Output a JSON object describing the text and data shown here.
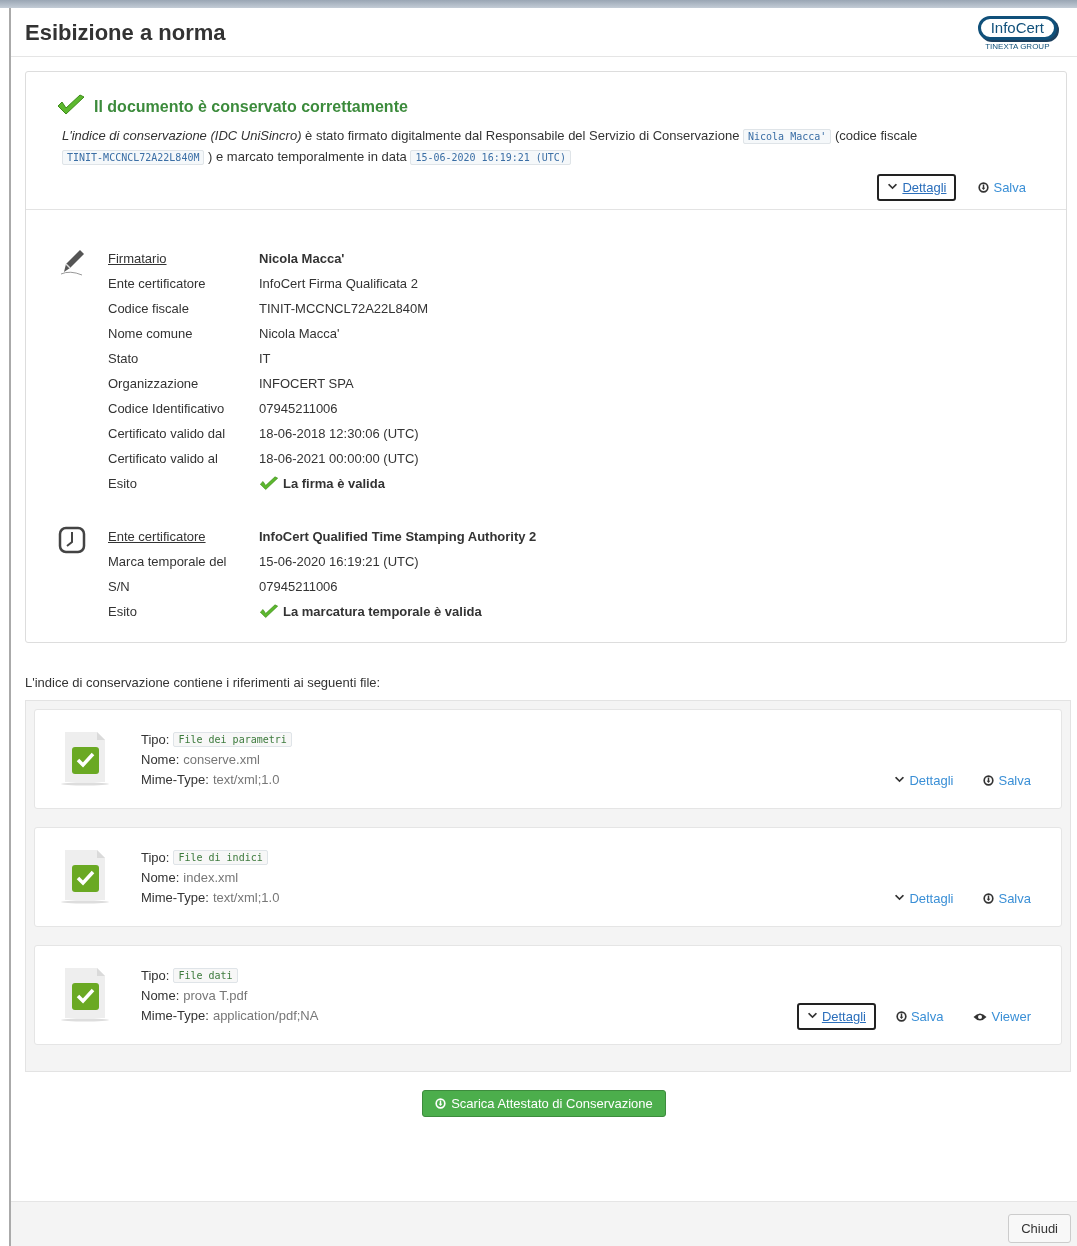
{
  "window": {
    "title": "Esibizione a norma",
    "logo": {
      "name": "InfoCert",
      "group": "TINEXTA GROUP"
    }
  },
  "summary": {
    "status": "Il documento è conservato correttamente",
    "paragraph": [
      {
        "kind": "italic",
        "text": "L'indice di conservazione (IDC UniSincro)"
      },
      {
        "kind": "text",
        "text": " è stato firmato digitalmente dal Responsabile del Servizio di Conservazione "
      },
      {
        "kind": "code",
        "text": "Nicola Macca'"
      },
      {
        "kind": "text",
        "text": " (codice fiscale "
      },
      {
        "kind": "code",
        "text": "TINIT-MCCNCL72A22L840M"
      },
      {
        "kind": "text",
        "text": " ) e marcato temporalmente in data "
      },
      {
        "kind": "code",
        "text": "15-06-2020 16:19:21 (UTC)"
      }
    ],
    "actions": [
      {
        "kind": "details",
        "label": "Dettagli",
        "focused": true
      },
      {
        "kind": "save",
        "label": "Salva",
        "focused": false
      }
    ]
  },
  "sections": [
    {
      "kind": "signature",
      "rows": [
        {
          "kind": "header",
          "label": "Firmatario",
          "value": "Nicola Macca'"
        },
        {
          "kind": "plain",
          "label": "Ente certificatore",
          "value": "InfoCert Firma Qualificata 2"
        },
        {
          "kind": "plain",
          "label": "Codice fiscale",
          "value": "TINIT-MCCNCL72A22L840M"
        },
        {
          "kind": "plain",
          "label": "Nome comune",
          "value": "Nicola Macca'"
        },
        {
          "kind": "plain",
          "label": "Stato",
          "value": "IT"
        },
        {
          "kind": "plain",
          "label": "Organizzazione",
          "value": "INFOCERT SPA"
        },
        {
          "kind": "plain",
          "label": "Codice Identificativo",
          "value": "07945211006"
        },
        {
          "kind": "plain",
          "label": "Certificato valido dal",
          "value": "18-06-2018 12:30:06 (UTC)"
        },
        {
          "kind": "plain",
          "label": "Certificato valido al",
          "value": "18-06-2021 00:00:00 (UTC)"
        },
        {
          "kind": "result",
          "label": "Esito",
          "value": "La firma è valida"
        }
      ]
    },
    {
      "kind": "timestamp",
      "rows": [
        {
          "kind": "header",
          "label": "Ente certificatore",
          "value": "InfoCert Qualified Time Stamping Authority 2"
        },
        {
          "kind": "plain",
          "label": "Marca temporale del",
          "value": "15-06-2020 16:19:21 (UTC)"
        },
        {
          "kind": "plain",
          "label": "S/N",
          "value": "07945211006"
        },
        {
          "kind": "result",
          "label": "Esito",
          "value": "La marcatura temporale è valida"
        }
      ]
    }
  ],
  "files_intro": "L'indice di conservazione contiene i riferimenti ai seguenti file:",
  "files": [
    {
      "tipo_label": "Tipo:",
      "tipo": "File dei parametri",
      "nome_label": "Nome:",
      "nome": "conserve.xml",
      "mime_label": "Mime-Type:",
      "mime": "text/xml;1.0",
      "actions": [
        {
          "kind": "details",
          "label": "Dettagli",
          "focused": false
        },
        {
          "kind": "save",
          "label": "Salva",
          "focused": false
        }
      ]
    },
    {
      "tipo_label": "Tipo:",
      "tipo": "File di indici",
      "nome_label": "Nome:",
      "nome": "index.xml",
      "mime_label": "Mime-Type:",
      "mime": "text/xml;1.0",
      "actions": [
        {
          "kind": "details",
          "label": "Dettagli",
          "focused": false
        },
        {
          "kind": "save",
          "label": "Salva",
          "focused": false
        }
      ]
    },
    {
      "tipo_label": "Tipo:",
      "tipo": "File dati",
      "nome_label": "Nome:",
      "nome": "prova T.pdf",
      "mime_label": "Mime-Type:",
      "mime": "application/pdf;NA",
      "actions": [
        {
          "kind": "details",
          "label": "Dettagli",
          "focused": true
        },
        {
          "kind": "save",
          "label": "Salva",
          "focused": false
        },
        {
          "kind": "viewer",
          "label": "Viewer",
          "focused": false
        }
      ]
    }
  ],
  "download_button": "Scarica Attestato di Conservazione",
  "footer": {
    "close_button": "Chiudi"
  }
}
